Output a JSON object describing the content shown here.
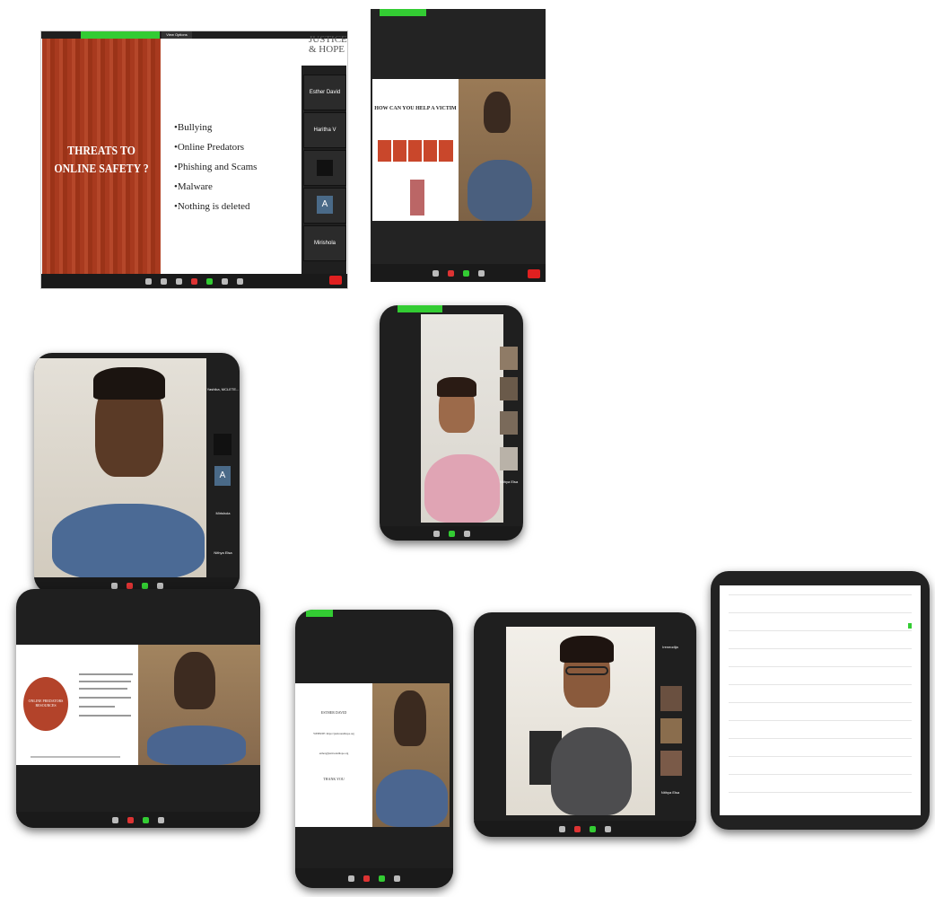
{
  "slide1": {
    "title_line1": "THREATS TO",
    "title_line2": "ONLINE SAFETY ?",
    "bullets": [
      "•Bullying",
      "•Online Predators",
      "•Phishing and Scams",
      "•Malware",
      "•Nothing is deleted"
    ],
    "logo_line1": "JUSTICE",
    "logo_line2": "& HOPE",
    "view_options": "View Options",
    "participants": [
      "Esther David",
      "Haritha V",
      "",
      "A",
      "Mirishola"
    ]
  },
  "slide2": {
    "title": "HOW CAN YOU HELP A VICTIM"
  },
  "shot3": {
    "participants": [
      "Yashika, MCLETE...",
      "",
      "A",
      "Mirishola",
      "Nithya Elsa"
    ]
  },
  "shot4": {
    "participants": [
      "",
      "",
      "",
      "Nithya Elsa"
    ]
  },
  "shot5": {
    "slide_title": "ONLINE PREDATORS RESOURCES"
  },
  "shot6": {
    "lines": [
      "ESTHER DAVID",
      "WEBSITE: https://justiceandhope.org",
      "esther@justiceandhope.org",
      "THANK YOU"
    ]
  },
  "shot7": {
    "participants": [
      "Ireneodija",
      "",
      "",
      "",
      "Nithya Elsa"
    ]
  },
  "colors": {
    "zoom_green": "#33cc33",
    "slide_red": "#a83a1f",
    "end_red": "#e02020"
  }
}
